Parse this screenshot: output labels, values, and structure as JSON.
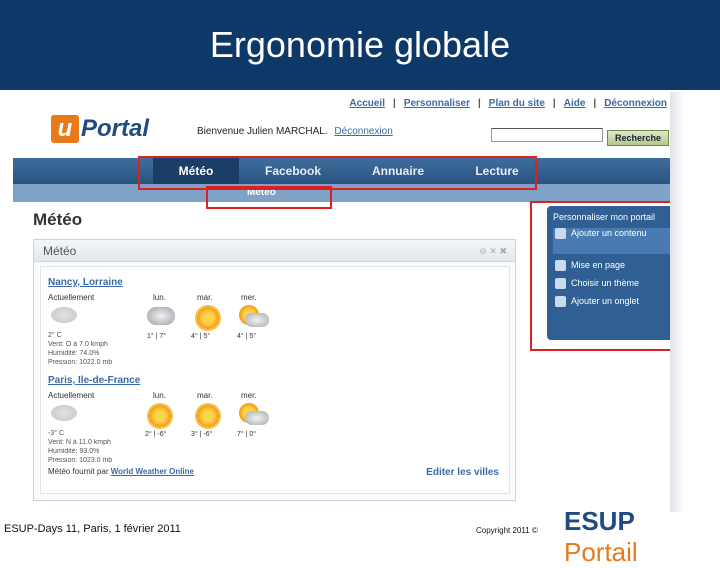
{
  "slide": {
    "title": "Ergonomie globale",
    "footer_left": "ESUP-Days 11, Paris, 1 février 2011",
    "footer_right": "Copyright 2011 ©",
    "footer_logo_pre": "ESUP",
    "footer_logo_post": "Portail"
  },
  "portal": {
    "top_links": [
      "Accueil",
      "Personnaliser",
      "Plan du site",
      "Aide",
      "Déconnexion"
    ],
    "logo_u": "u",
    "logo_text": "Portal",
    "welcome": "Bienvenue Julien MARCHAL.",
    "welcome_link": "Déconnexion",
    "search_value": "",
    "search_button": "Recherche",
    "tabs": [
      "Météo",
      "Facebook",
      "Annuaire",
      "Lecture"
    ],
    "active_tab": "Météo",
    "subtab": "Météo",
    "page_title": "Météo"
  },
  "portlet": {
    "title": "Météo",
    "controls": "⊖ ✕ ✖",
    "days": [
      "Actuellement",
      "lun.",
      "mar.",
      "mer."
    ],
    "cities": [
      {
        "name": "Nancy, Lorraine",
        "current_temp": "2° C",
        "forecasts": [
          "1° | 7°",
          "4° | 5°",
          "4° | 5°"
        ],
        "details": [
          "Vent: O à 7.0 kmph",
          "Humidité: 74.0%",
          "Pression: 1022.0 mb"
        ]
      },
      {
        "name": "Paris, Ile-de-France",
        "current_temp": "-3° C",
        "forecasts": [
          "2° | -6°",
          "3° | -6°",
          "7° | 0°"
        ],
        "details": [
          "Vent: N à 11.0 kmph",
          "Humidité: 93.0%",
          "Pression: 1023.0 mb"
        ]
      }
    ],
    "provided_by": "Météo fournit par",
    "provider_link": "World Weather Online",
    "edit_cities": "Editer les villes"
  },
  "customize": {
    "title": "Personnaliser mon portail",
    "items": [
      "Ajouter un contenu",
      "Mise en page",
      "Choisir un thème",
      "Ajouter un onglet"
    ]
  },
  "colors": {
    "header_blue": "#0d3868",
    "nav_blue": "#2a5280",
    "highlight_red": "#e02020",
    "accent_orange": "#e87a1e"
  }
}
